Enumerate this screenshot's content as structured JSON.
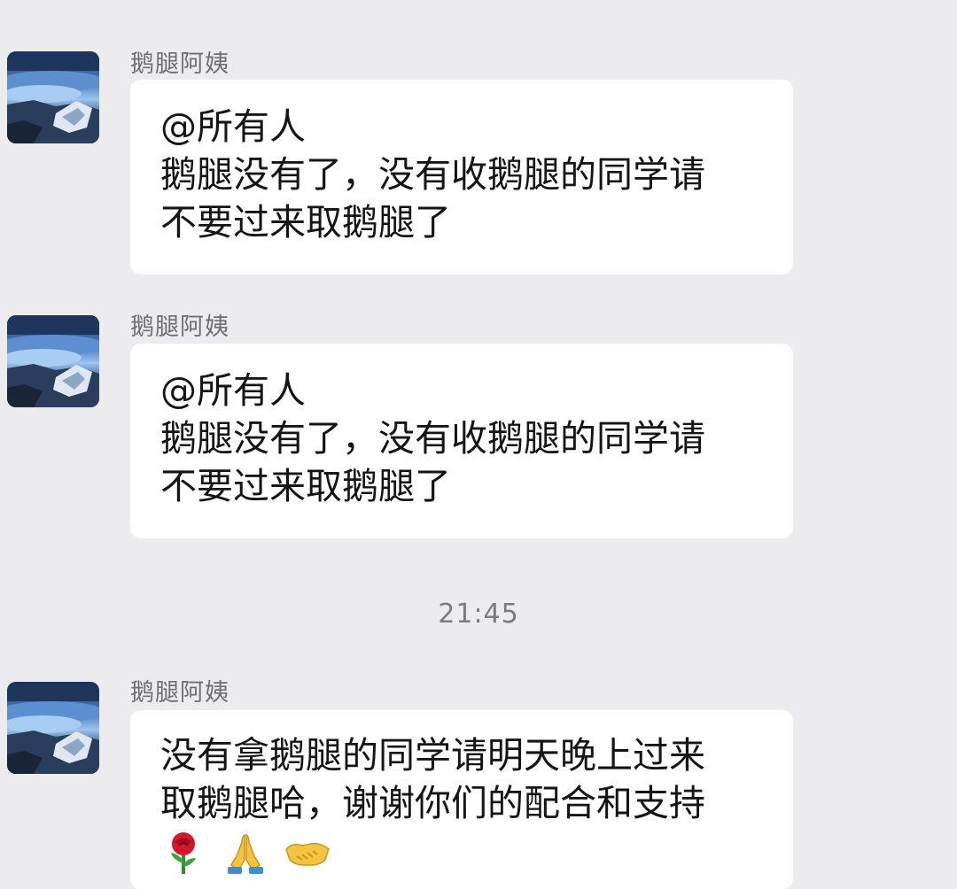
{
  "timestamp": "21:45",
  "messages": [
    {
      "sender": "鹅腿阿姨",
      "lines": [
        "@所有人",
        "鹅腿没有了，没有收鹅腿的同学请",
        "不要过来取鹅腿了"
      ]
    },
    {
      "sender": "鹅腿阿姨",
      "lines": [
        "@所有人",
        "鹅腿没有了，没有收鹅腿的同学请",
        "不要过来取鹅腿了"
      ]
    },
    {
      "sender": "鹅腿阿姨",
      "lines": [
        "没有拿鹅腿的同学请明天晚上过来",
        "取鹅腿哈，谢谢你们的配合和支持"
      ],
      "emojis": [
        "rose-emoji",
        "praying-hands-emoji",
        "handshake-emoji"
      ]
    }
  ],
  "colors": {
    "background": "#ececef",
    "bubble": "#ffffff",
    "sender_text": "#6f6f73",
    "message_text": "#151515"
  }
}
